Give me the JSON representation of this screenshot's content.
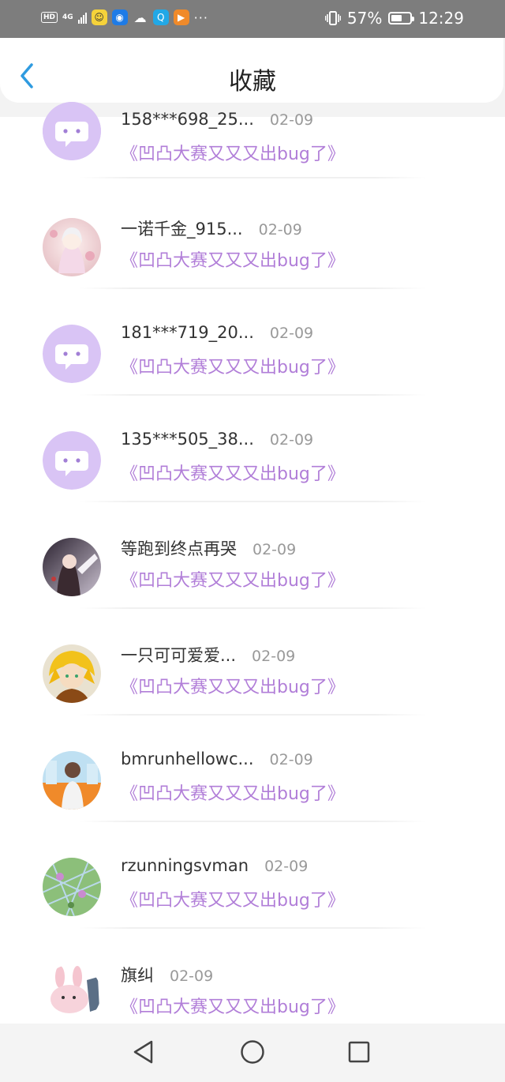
{
  "status_bar": {
    "hd": "HD",
    "network": "4G",
    "battery_percent": "57%",
    "battery_level": 0.57,
    "time": "12:29",
    "overflow": "···"
  },
  "header": {
    "title": "收藏"
  },
  "items": [
    {
      "name": "158***698_25...",
      "date": "02-09",
      "work": "《凹凸大赛又又又出bug了》",
      "avatar": "default-chat-avatar"
    },
    {
      "name": "一诺千金_915...",
      "date": "02-09",
      "work": "《凹凸大赛又又又出bug了》",
      "avatar": "anime-girl-avatar"
    },
    {
      "name": "181***719_20...",
      "date": "02-09",
      "work": "《凹凸大赛又又又出bug了》",
      "avatar": "default-chat-avatar"
    },
    {
      "name": "135***505_38...",
      "date": "02-09",
      "work": "《凹凸大赛又又又出bug了》",
      "avatar": "default-chat-avatar"
    },
    {
      "name": "等跑到终点再哭",
      "date": "02-09",
      "work": "《凹凸大赛又又又出bug了》",
      "avatar": "anime-dark-avatar"
    },
    {
      "name": "一只可可爱爱...",
      "date": "02-09",
      "work": "《凹凸大赛又又又出bug了》",
      "avatar": "blonde-character-avatar"
    },
    {
      "name": "bmrunhellowc...",
      "date": "02-09",
      "work": "《凹凸大赛又又又出bug了》",
      "avatar": "person-photo-avatar"
    },
    {
      "name": "rzunningsvman",
      "date": "02-09",
      "work": "《凹凸大赛又又又出bug了》",
      "avatar": "nature-photo-avatar"
    },
    {
      "name": "旗纠",
      "date": "02-09",
      "work": "《凹凸大赛又又又出bug了》",
      "avatar": "bunny-sticker-avatar"
    }
  ],
  "colors": {
    "accent_purple": "#b17ed8",
    "default_avatar_bg": "#d9c4f5",
    "back_arrow": "#2f9be0",
    "status_bar_bg": "#7d7d7d"
  }
}
